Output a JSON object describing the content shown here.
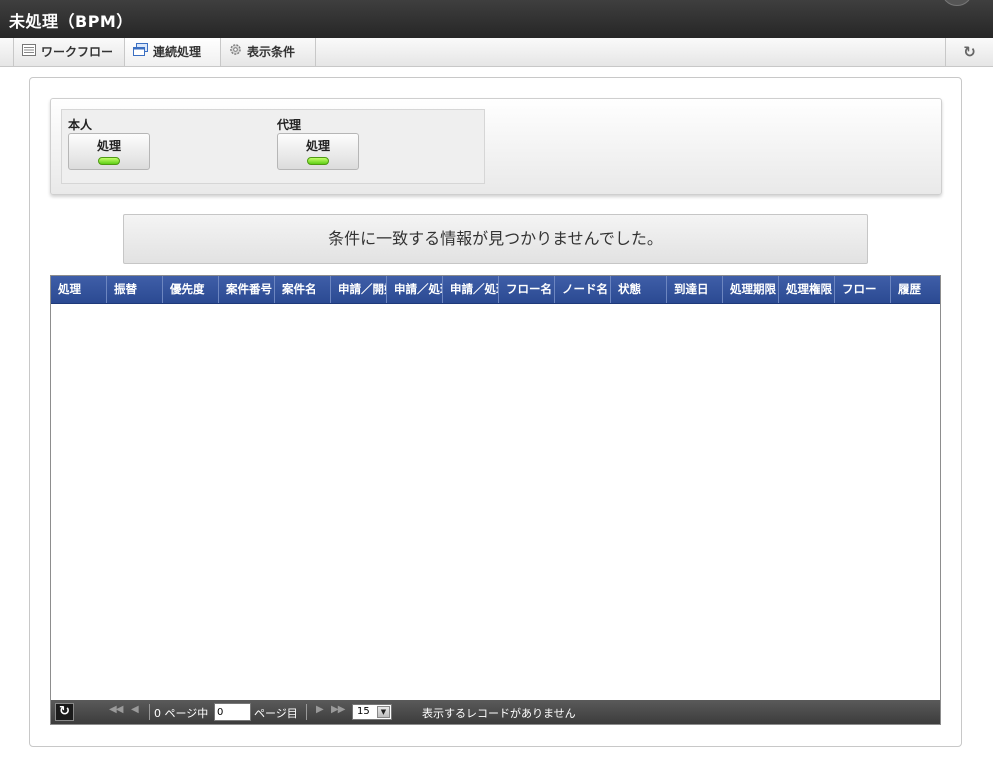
{
  "window": {
    "title": "未処理（BPM）"
  },
  "toolbar": {
    "tabs": [
      {
        "label": "ワークフロー",
        "icon": "list-icon"
      },
      {
        "label": "連続処理",
        "icon": "windows-icon"
      },
      {
        "label": "表示条件",
        "icon": "gear-icon"
      }
    ],
    "refresh_icon": "refresh-icon"
  },
  "mode_panel": {
    "self": {
      "label": "本人",
      "button": "処理"
    },
    "proxy": {
      "label": "代理",
      "button": "処理"
    }
  },
  "message": "条件に一致する情報が見つかりませんでした。",
  "grid": {
    "columns": [
      "処理",
      "振替",
      "優先度",
      "案件番号",
      "案件名",
      "申請／開始",
      "申請／処理",
      "申請／処理",
      "フロー名",
      "ノード名",
      "状態",
      "到達日",
      "処理期限",
      "処理権限",
      "フロー",
      "履歴"
    ]
  },
  "pager": {
    "page_prefix": "0 ページ中",
    "page_value": "0",
    "page_suffix": "ページ目",
    "page_size": "15",
    "status": "表示するレコードがありません"
  },
  "colors": {
    "titlebar": "#2f2f2f",
    "grid_header": "#33529b",
    "led_green": "#7ae32a",
    "pager_bg": "#4a4a4a"
  }
}
